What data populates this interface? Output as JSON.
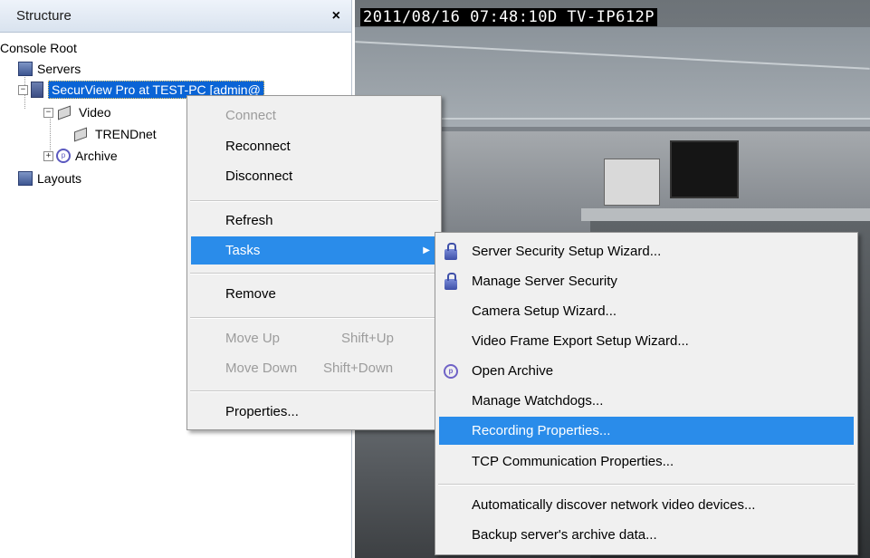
{
  "panel": {
    "title": "Structure",
    "close": "×"
  },
  "tree": {
    "console_root": "Console Root",
    "servers": "Servers",
    "server": "SecurView Pro at TEST-PC [admin@",
    "video": "Video",
    "camera": "TRENDnet",
    "archive": "Archive",
    "layouts": "Layouts"
  },
  "video": {
    "osd": "2011/08/16 07:48:10D TV-IP612P"
  },
  "context_menu": {
    "connect": "Connect",
    "reconnect": "Reconnect",
    "disconnect": "Disconnect",
    "refresh": "Refresh",
    "tasks": "Tasks",
    "remove": "Remove",
    "move_up": "Move Up",
    "move_up_shortcut": "Shift+Up",
    "move_down": "Move Down",
    "move_down_shortcut": "Shift+Down",
    "properties": "Properties..."
  },
  "tasks_menu": {
    "server_security_wizard": "Server Security Setup Wizard...",
    "manage_server_security": "Manage Server Security",
    "camera_setup_wizard": "Camera Setup Wizard...",
    "video_frame_export_wizard": "Video Frame Export Setup Wizard...",
    "open_archive": "Open Archive",
    "manage_watchdogs": "Manage Watchdogs...",
    "recording_properties": "Recording Properties...",
    "tcp_communication_properties": "TCP Communication Properties...",
    "auto_discover": "Automatically discover network video devices...",
    "backup_archive": "Backup server's archive data..."
  },
  "colors": {
    "highlight": "#2a8cea",
    "selection": "#0a64d6",
    "disabled_text": "#9c9c9c"
  }
}
